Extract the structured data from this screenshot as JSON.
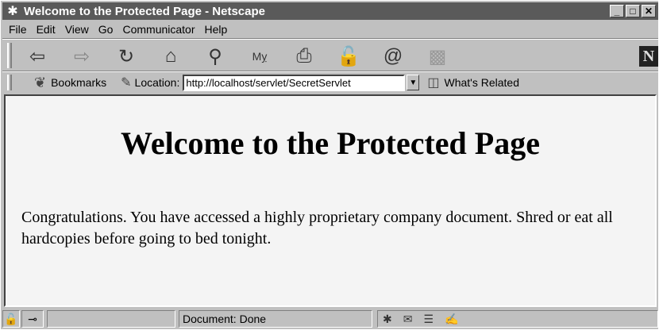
{
  "window": {
    "title": "Welcome to the Protected Page - Netscape"
  },
  "menu": [
    "File",
    "Edit",
    "View",
    "Go",
    "Communicator",
    "Help"
  ],
  "toolbar": {
    "bookmarks_label": "Bookmarks",
    "location_label": "Location:",
    "url": "http://localhost/servlet/SecretServlet",
    "related_label": "What's Related",
    "logo": "N"
  },
  "page": {
    "heading": "Welcome to the Protected Page",
    "paragraph": "Congratulations. You have accessed a highly proprietary company document. Shred or eat all hardcopies before going to bed tonight."
  },
  "status": {
    "text": "Document: Done"
  }
}
